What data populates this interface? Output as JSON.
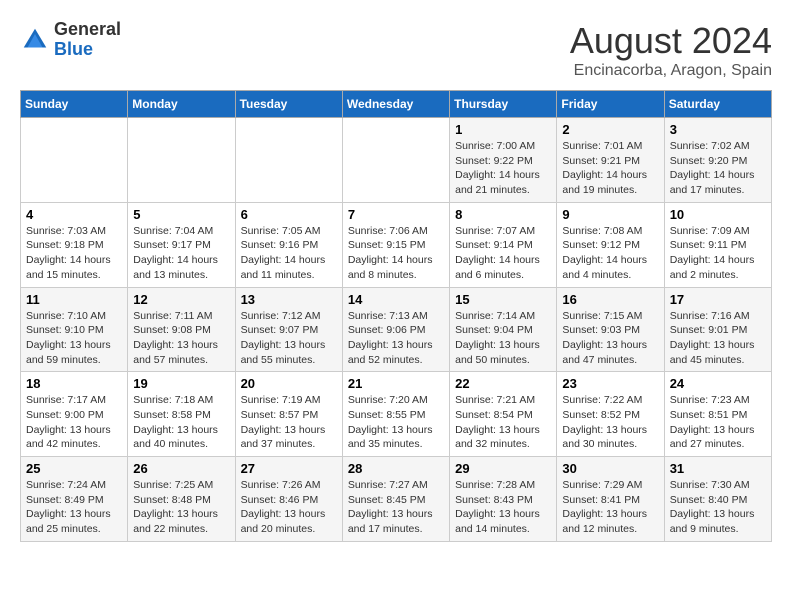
{
  "header": {
    "logo_general": "General",
    "logo_blue": "Blue",
    "title": "August 2024",
    "location": "Encinacorba, Aragon, Spain"
  },
  "days_of_week": [
    "Sunday",
    "Monday",
    "Tuesday",
    "Wednesday",
    "Thursday",
    "Friday",
    "Saturday"
  ],
  "weeks": [
    [
      {
        "day": "",
        "info": ""
      },
      {
        "day": "",
        "info": ""
      },
      {
        "day": "",
        "info": ""
      },
      {
        "day": "",
        "info": ""
      },
      {
        "day": "1",
        "info": "Sunrise: 7:00 AM\nSunset: 9:22 PM\nDaylight: 14 hours\nand 21 minutes."
      },
      {
        "day": "2",
        "info": "Sunrise: 7:01 AM\nSunset: 9:21 PM\nDaylight: 14 hours\nand 19 minutes."
      },
      {
        "day": "3",
        "info": "Sunrise: 7:02 AM\nSunset: 9:20 PM\nDaylight: 14 hours\nand 17 minutes."
      }
    ],
    [
      {
        "day": "4",
        "info": "Sunrise: 7:03 AM\nSunset: 9:18 PM\nDaylight: 14 hours\nand 15 minutes."
      },
      {
        "day": "5",
        "info": "Sunrise: 7:04 AM\nSunset: 9:17 PM\nDaylight: 14 hours\nand 13 minutes."
      },
      {
        "day": "6",
        "info": "Sunrise: 7:05 AM\nSunset: 9:16 PM\nDaylight: 14 hours\nand 11 minutes."
      },
      {
        "day": "7",
        "info": "Sunrise: 7:06 AM\nSunset: 9:15 PM\nDaylight: 14 hours\nand 8 minutes."
      },
      {
        "day": "8",
        "info": "Sunrise: 7:07 AM\nSunset: 9:14 PM\nDaylight: 14 hours\nand 6 minutes."
      },
      {
        "day": "9",
        "info": "Sunrise: 7:08 AM\nSunset: 9:12 PM\nDaylight: 14 hours\nand 4 minutes."
      },
      {
        "day": "10",
        "info": "Sunrise: 7:09 AM\nSunset: 9:11 PM\nDaylight: 14 hours\nand 2 minutes."
      }
    ],
    [
      {
        "day": "11",
        "info": "Sunrise: 7:10 AM\nSunset: 9:10 PM\nDaylight: 13 hours\nand 59 minutes."
      },
      {
        "day": "12",
        "info": "Sunrise: 7:11 AM\nSunset: 9:08 PM\nDaylight: 13 hours\nand 57 minutes."
      },
      {
        "day": "13",
        "info": "Sunrise: 7:12 AM\nSunset: 9:07 PM\nDaylight: 13 hours\nand 55 minutes."
      },
      {
        "day": "14",
        "info": "Sunrise: 7:13 AM\nSunset: 9:06 PM\nDaylight: 13 hours\nand 52 minutes."
      },
      {
        "day": "15",
        "info": "Sunrise: 7:14 AM\nSunset: 9:04 PM\nDaylight: 13 hours\nand 50 minutes."
      },
      {
        "day": "16",
        "info": "Sunrise: 7:15 AM\nSunset: 9:03 PM\nDaylight: 13 hours\nand 47 minutes."
      },
      {
        "day": "17",
        "info": "Sunrise: 7:16 AM\nSunset: 9:01 PM\nDaylight: 13 hours\nand 45 minutes."
      }
    ],
    [
      {
        "day": "18",
        "info": "Sunrise: 7:17 AM\nSunset: 9:00 PM\nDaylight: 13 hours\nand 42 minutes."
      },
      {
        "day": "19",
        "info": "Sunrise: 7:18 AM\nSunset: 8:58 PM\nDaylight: 13 hours\nand 40 minutes."
      },
      {
        "day": "20",
        "info": "Sunrise: 7:19 AM\nSunset: 8:57 PM\nDaylight: 13 hours\nand 37 minutes."
      },
      {
        "day": "21",
        "info": "Sunrise: 7:20 AM\nSunset: 8:55 PM\nDaylight: 13 hours\nand 35 minutes."
      },
      {
        "day": "22",
        "info": "Sunrise: 7:21 AM\nSunset: 8:54 PM\nDaylight: 13 hours\nand 32 minutes."
      },
      {
        "day": "23",
        "info": "Sunrise: 7:22 AM\nSunset: 8:52 PM\nDaylight: 13 hours\nand 30 minutes."
      },
      {
        "day": "24",
        "info": "Sunrise: 7:23 AM\nSunset: 8:51 PM\nDaylight: 13 hours\nand 27 minutes."
      }
    ],
    [
      {
        "day": "25",
        "info": "Sunrise: 7:24 AM\nSunset: 8:49 PM\nDaylight: 13 hours\nand 25 minutes."
      },
      {
        "day": "26",
        "info": "Sunrise: 7:25 AM\nSunset: 8:48 PM\nDaylight: 13 hours\nand 22 minutes."
      },
      {
        "day": "27",
        "info": "Sunrise: 7:26 AM\nSunset: 8:46 PM\nDaylight: 13 hours\nand 20 minutes."
      },
      {
        "day": "28",
        "info": "Sunrise: 7:27 AM\nSunset: 8:45 PM\nDaylight: 13 hours\nand 17 minutes."
      },
      {
        "day": "29",
        "info": "Sunrise: 7:28 AM\nSunset: 8:43 PM\nDaylight: 13 hours\nand 14 minutes."
      },
      {
        "day": "30",
        "info": "Sunrise: 7:29 AM\nSunset: 8:41 PM\nDaylight: 13 hours\nand 12 minutes."
      },
      {
        "day": "31",
        "info": "Sunrise: 7:30 AM\nSunset: 8:40 PM\nDaylight: 13 hours\nand 9 minutes."
      }
    ]
  ]
}
